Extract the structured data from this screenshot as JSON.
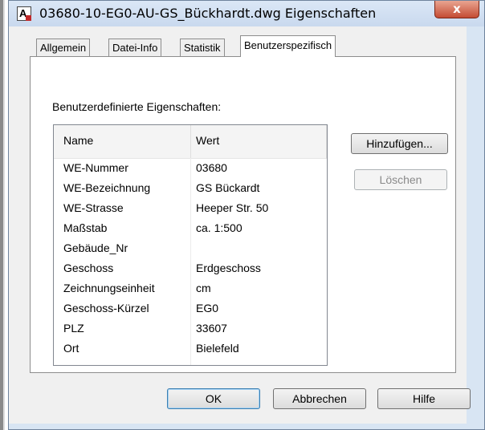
{
  "window": {
    "title": "03680-10-EG0-AU-GS_Bückhardt.dwg Eigenschaften",
    "app_icon_letter": "A",
    "close_glyph": "x"
  },
  "tabs": [
    {
      "label": "Allgemein",
      "active": false
    },
    {
      "label": "Datei-Info",
      "active": false
    },
    {
      "label": "Statistik",
      "active": false
    },
    {
      "label": "Benutzerspezifisch",
      "active": true
    }
  ],
  "custom": {
    "group_label": "Benutzerdefinierte Eigenschaften:",
    "columns": {
      "name": "Name",
      "value": "Wert"
    },
    "rows": [
      {
        "name": "WE-Nummer",
        "value": "03680"
      },
      {
        "name": "WE-Bezeichnung",
        "value": "GS Bückardt"
      },
      {
        "name": "WE-Strasse",
        "value": "Heeper Str. 50"
      },
      {
        "name": "Maßstab",
        "value": "ca. 1:500"
      },
      {
        "name": "Gebäude_Nr",
        "value": ""
      },
      {
        "name": "Geschoss",
        "value": "Erdgeschoss"
      },
      {
        "name": "Zeichnungseinheit",
        "value": "cm"
      },
      {
        "name": "Geschoss-Kürzel",
        "value": "EG0"
      },
      {
        "name": "PLZ",
        "value": "33607"
      },
      {
        "name": "Ort",
        "value": "Bielefeld"
      }
    ]
  },
  "buttons": {
    "add": "Hinzufügen...",
    "delete": "Löschen",
    "ok": "OK",
    "cancel": "Abbrechen",
    "help": "Hilfe"
  },
  "colors": {
    "window_frame": "#d8e5f3",
    "close_button": "#c44b33",
    "default_button_border": "#3c7fb1"
  }
}
